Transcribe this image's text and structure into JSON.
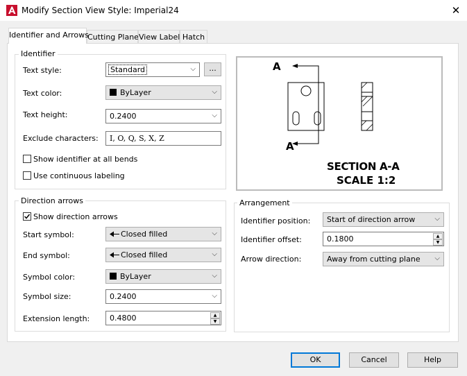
{
  "window": {
    "title": "Modify Section View Style: Imperial24",
    "close_glyph": "✕"
  },
  "tabs": [
    {
      "label": "Identifier and Arrows"
    },
    {
      "label": "Cutting Plane"
    },
    {
      "label": "View Label"
    },
    {
      "label": "Hatch"
    }
  ],
  "identifier": {
    "legend": "Identifier",
    "text_style_label": "Text style:",
    "text_style_value": "Standard",
    "browse_label": "...",
    "text_color_label": "Text color:",
    "text_color_value": "ByLayer",
    "text_height_label": "Text height:",
    "text_height_value": "0.2400",
    "exclude_label": "Exclude characters:",
    "exclude_value": "I, O, Q, S, X, Z",
    "show_all_bends_label": "Show identifier at all bends",
    "show_all_bends_checked": false,
    "continuous_label": "Use continuous labeling",
    "continuous_checked": false
  },
  "direction_arrows": {
    "legend": "Direction arrows",
    "show_label": "Show direction arrows",
    "show_checked": true,
    "start_label": "Start symbol:",
    "start_value": "Closed filled",
    "end_label": "End symbol:",
    "end_value": "Closed filled",
    "symbol_color_label": "Symbol color:",
    "symbol_color_value": "ByLayer",
    "symbol_size_label": "Symbol size:",
    "symbol_size_value": "0.2400",
    "extension_label": "Extension length:",
    "extension_value": "0.4800"
  },
  "preview": {
    "marker_top": "A",
    "marker_bottom": "A",
    "section_title": "SECTION A-A",
    "scale_text": "SCALE 1:2"
  },
  "arrangement": {
    "legend": "Arrangement",
    "position_label": "Identifier position:",
    "position_value": "Start of direction arrow",
    "offset_label": "Identifier offset:",
    "offset_value": "0.1800",
    "direction_label": "Arrow direction:",
    "direction_value": "Away from cutting plane"
  },
  "buttons": {
    "ok": "OK",
    "cancel": "Cancel",
    "help": "Help"
  }
}
